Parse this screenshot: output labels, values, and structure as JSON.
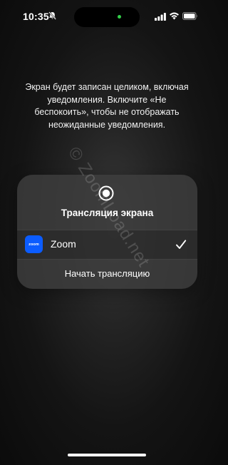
{
  "status_bar": {
    "time": "10:35",
    "mute_icon": "bell-slash-icon",
    "signal_icon": "cellular-signal-icon",
    "wifi_icon": "wifi-icon",
    "battery_icon": "battery-icon",
    "camera_indicator_color": "#33d14a"
  },
  "info_text": "Экран будет записан целиком, включая уведомления. Включите «Не беспокоить», чтобы не отображать неожиданные уведомления.",
  "dialog": {
    "icon": "screen-record-icon",
    "title": "Трансляция экрана",
    "apps": [
      {
        "name": "Zoom",
        "icon_text": "zoom",
        "icon_color": "#0b5cff",
        "selected": true
      }
    ],
    "start_button": "Начать трансляцию"
  },
  "watermark": "© ZoomLoad.net"
}
